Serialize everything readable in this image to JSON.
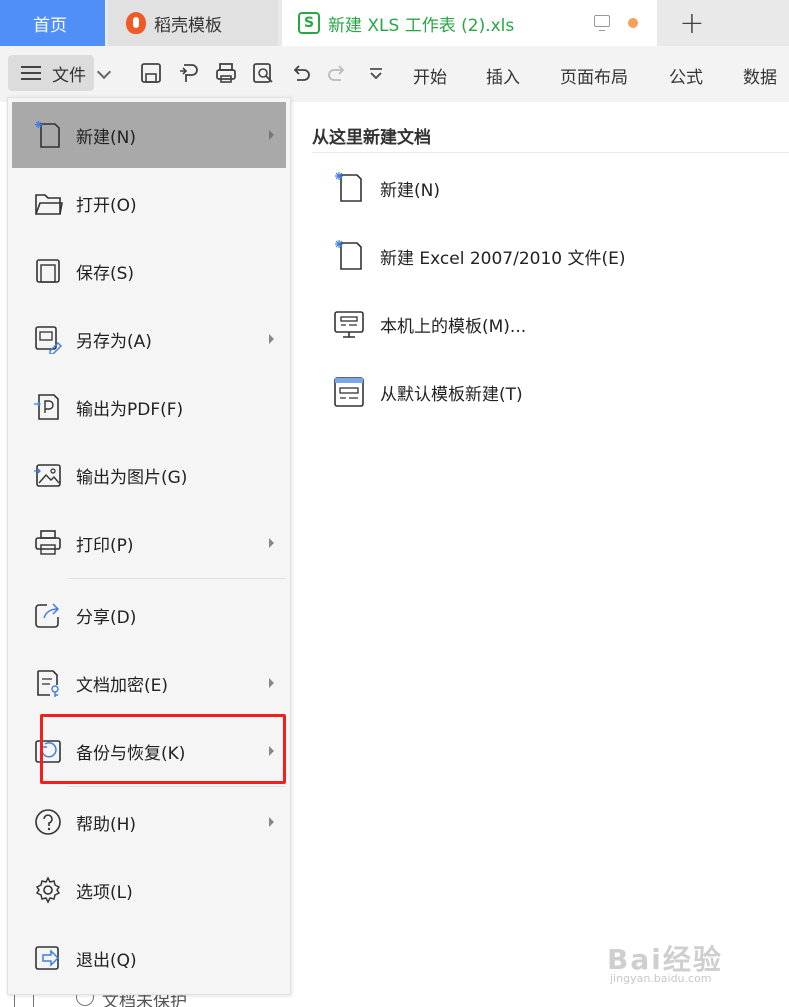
{
  "tabs": {
    "home": "首页",
    "daoke": "稻壳模板",
    "file": "新建 XLS 工作表 (2).xls",
    "add": "+"
  },
  "toolbar": {
    "file_label": "文件",
    "ribbon": [
      "开始",
      "插入",
      "页面布局",
      "公式",
      "数据"
    ],
    "icons": [
      "save-icon",
      "export-pdf-icon",
      "print-icon",
      "print-preview-icon",
      "undo-icon",
      "redo-icon",
      "more-icon"
    ]
  },
  "menu": {
    "items": [
      {
        "label": "新建(N)",
        "icon": "new-doc-icon",
        "submenu": true,
        "active": true
      },
      {
        "label": "打开(O)",
        "icon": "folder-open-icon",
        "submenu": false
      },
      {
        "label": "保存(S)",
        "icon": "save-icon",
        "submenu": false
      },
      {
        "label": "另存为(A)",
        "icon": "save-as-icon",
        "submenu": true
      },
      {
        "label": "输出为PDF(F)",
        "icon": "export-pdf-icon",
        "submenu": false
      },
      {
        "label": "输出为图片(G)",
        "icon": "export-image-icon",
        "submenu": false
      },
      {
        "label": "打印(P)",
        "icon": "print-icon",
        "submenu": true
      },
      {
        "label": "分享(D)",
        "icon": "share-icon",
        "submenu": false
      },
      {
        "label": "文档加密(E)",
        "icon": "encrypt-icon",
        "submenu": true
      },
      {
        "label": "备份与恢复(K)",
        "icon": "backup-icon",
        "submenu": true,
        "highlighted": true
      },
      {
        "label": "帮助(H)",
        "icon": "help-icon",
        "submenu": true
      },
      {
        "label": "选项(L)",
        "icon": "options-gear-icon",
        "submenu": false
      },
      {
        "label": "退出(Q)",
        "icon": "exit-icon",
        "submenu": false
      }
    ]
  },
  "panel": {
    "title": "从这里新建文档",
    "items": [
      {
        "label": "新建(N)",
        "icon": "new-doc-icon"
      },
      {
        "label": "新建 Excel 2007/2010 文件(E)",
        "icon": "new-excel-icon"
      },
      {
        "label": "本机上的模板(M)...",
        "icon": "local-template-icon"
      },
      {
        "label": "从默认模板新建(T)",
        "icon": "default-template-icon"
      }
    ]
  },
  "status": {
    "protect": "文档未保护"
  },
  "watermark": {
    "text": "Bai经验",
    "sub": "jingyan.baidu.com"
  },
  "colors": {
    "accent_blue": "#4f8ff7",
    "file_green": "#28a745",
    "highlight_red": "#f21f1f",
    "active_row": "#a9a9a9"
  }
}
